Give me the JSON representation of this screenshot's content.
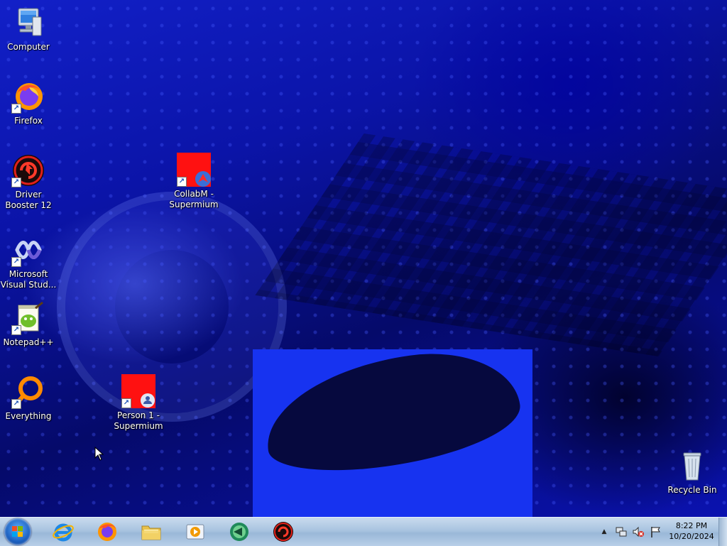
{
  "desktop_icons": {
    "computer": "Computer",
    "firefox": "Firefox",
    "driver_booster": "Driver Booster 12",
    "collabm": "CollabM - Supermium",
    "visual_studio": "Microsoft Visual Stud...",
    "notepadpp": "Notepad++",
    "everything": "Everything",
    "person1": "Person 1 - Supermium",
    "recycle_bin": "Recycle Bin"
  },
  "taskbar": {
    "pinned_apps": [
      "Internet Explorer",
      "Firefox",
      "Windows Explorer",
      "Windows Media Player",
      "App",
      "Driver Booster"
    ]
  },
  "tray": {
    "time": "8:22 PM",
    "date": "10/20/2024",
    "icons": [
      "show-hidden-icons-arrow",
      "network-icon",
      "volume-muted-icon",
      "action-center-flag-icon"
    ]
  },
  "colors": {
    "desktop_blue": "#0b14a8",
    "taskbar": "#a9c4e0",
    "supermium_red": "#ff1111"
  }
}
